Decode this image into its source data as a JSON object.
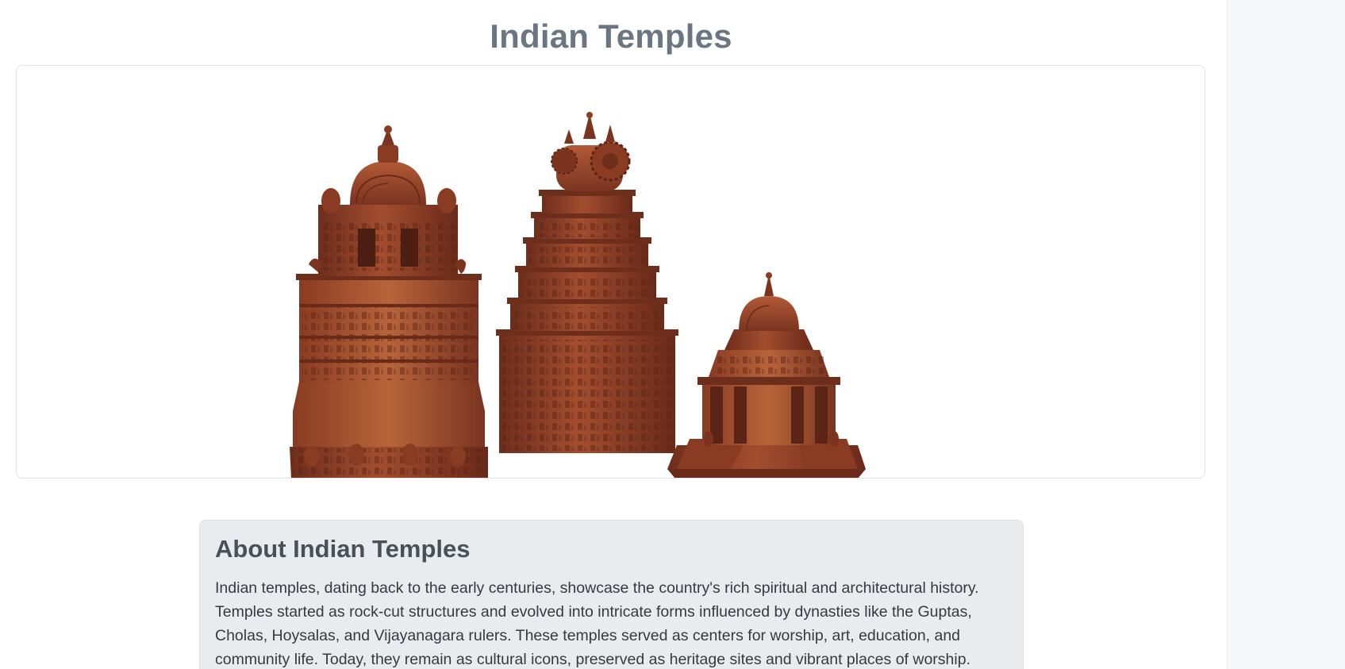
{
  "header": {
    "title": "Indian Temples"
  },
  "viewer": {
    "models": [
      {
        "icon": "temple-model-gopuram-dome"
      },
      {
        "icon": "temple-model-tiered-tower"
      },
      {
        "icon": "temple-model-domed-shrine"
      }
    ],
    "colors": {
      "stone_dark": "#7a3420",
      "stone_mid": "#a34d2e",
      "stone_light": "#c27448",
      "stone_shadow": "#5a2416"
    }
  },
  "about": {
    "title": "About Indian Temples",
    "text": "Indian temples, dating back to the early centuries, showcase the country's rich spiritual and architectural history. Temples started as rock-cut structures and evolved into intricate forms influenced by dynasties like the Guptas, Cholas, Hoysalas, and Vijayanagara rulers. These temples served as centers for worship, art, education, and community life. Today, they remain as cultural icons, preserved as heritage sites and vibrant places of worship."
  }
}
